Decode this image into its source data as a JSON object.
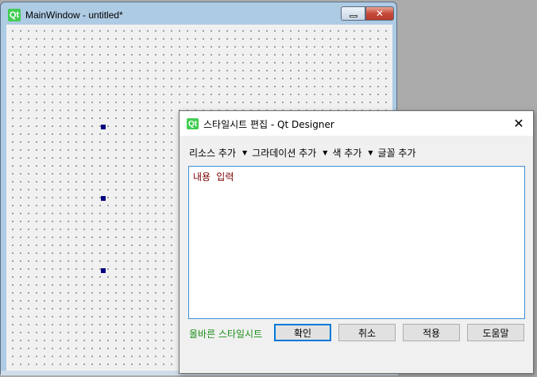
{
  "main_window": {
    "title": "MainWindow - untitled*",
    "logo_text": "Qt",
    "close_glyph": "✕"
  },
  "dialog": {
    "logo_text": "Qt",
    "title": "스타일시트 편집 - Qt Designer",
    "close_glyph": "✕",
    "toolbar": [
      {
        "label": "리소스 추가"
      },
      {
        "label": "그라데이션 추가"
      },
      {
        "label": "색 추가"
      },
      {
        "label": "글꼴 추가"
      }
    ],
    "arrow_glyph": "▼",
    "editor_text": "내용 입력",
    "status": "올바른 스타일시트",
    "buttons": {
      "ok": "확인",
      "cancel": "취소",
      "apply": "적용",
      "help": "도움말"
    }
  },
  "colors": {
    "status_green": "#1a8f1a",
    "editor_text": "#7a0000",
    "qt_green": "#41cd52",
    "focus_blue": "#0078d7"
  }
}
